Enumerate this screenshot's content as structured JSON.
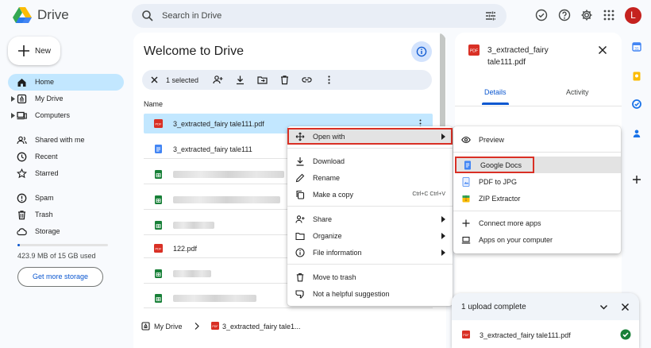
{
  "app": {
    "name": "Drive"
  },
  "search": {
    "placeholder": "Search in Drive"
  },
  "user": {
    "avatar_letter": "L"
  },
  "sidebar": {
    "new_label": "New",
    "items": [
      {
        "label": "Home",
        "icon": "home-icon",
        "active": true
      },
      {
        "label": "My Drive",
        "icon": "my-drive-icon"
      },
      {
        "label": "Computers",
        "icon": "computers-icon"
      },
      {
        "label": "Shared with me",
        "icon": "shared-icon"
      },
      {
        "label": "Recent",
        "icon": "clock-icon"
      },
      {
        "label": "Starred",
        "icon": "star-icon"
      },
      {
        "label": "Spam",
        "icon": "spam-icon"
      },
      {
        "label": "Trash",
        "icon": "trash-icon"
      },
      {
        "label": "Storage",
        "icon": "cloud-icon"
      }
    ],
    "storage_used": "423.9 MB of 15 GB used",
    "storage_fraction": 0.028,
    "get_storage": "Get more storage"
  },
  "main": {
    "title": "Welcome to Drive",
    "selection": "1 selected",
    "column_name": "Name",
    "files": [
      {
        "name": "3_extracted_fairy tale111.pdf",
        "type": "pdf"
      },
      {
        "name": "3_extracted_fairy tale111",
        "type": "doc"
      },
      {
        "name": "",
        "type": "sheet",
        "obscured": true
      },
      {
        "name": "",
        "type": "sheet",
        "obscured": true
      },
      {
        "name": "",
        "type": "sheet",
        "obscured": true
      },
      {
        "name": "122.pdf",
        "type": "pdf"
      },
      {
        "name": "",
        "type": "sheet",
        "obscured": true
      },
      {
        "name": "",
        "type": "sheet",
        "obscured": true
      }
    ],
    "breadcrumb": {
      "root": "My Drive",
      "file": "3_extracted_fairy tale1..."
    }
  },
  "context_menu": {
    "items": [
      {
        "label": "Open with",
        "icon": "move-icon",
        "submenu": true
      },
      {
        "label": "Download",
        "icon": "download-icon"
      },
      {
        "label": "Rename",
        "icon": "rename-icon"
      },
      {
        "label": "Make a copy",
        "icon": "copy-icon",
        "shortcut": "Ctrl+C Ctrl+V"
      },
      {
        "label": "Share",
        "icon": "share-icon",
        "submenu": true
      },
      {
        "label": "Organize",
        "icon": "folder-icon",
        "submenu": true
      },
      {
        "label": "File information",
        "icon": "info-icon",
        "submenu": true
      },
      {
        "label": "Move to trash",
        "icon": "trash-icon"
      },
      {
        "label": "Not a helpful suggestion",
        "icon": "thumb-down-icon"
      }
    ]
  },
  "open_with_menu": {
    "items": [
      {
        "label": "Preview",
        "icon": "eye-icon"
      },
      {
        "label": "Google Docs",
        "icon": "docs-icon"
      },
      {
        "label": "PDF to JPG",
        "icon": "pdf-to-jpg-icon"
      },
      {
        "label": "ZIP Extractor",
        "icon": "zip-icon"
      },
      {
        "label": "Connect more apps",
        "icon": "plus-icon"
      },
      {
        "label": "Apps on your computer",
        "icon": "laptop-icon"
      }
    ]
  },
  "details": {
    "title": "3_extracted_fairy tale111.pdf",
    "tabs": [
      "Details",
      "Activity"
    ]
  },
  "upload": {
    "title": "1 upload complete",
    "file": "3_extracted_fairy tale111.pdf"
  },
  "colors": {
    "accent": "#0b57d0",
    "selected": "#c2e7ff",
    "highlight_box": "#d93025",
    "pdf_red": "#d93025",
    "docs_blue": "#4285f4",
    "sheets_green": "#188038"
  }
}
